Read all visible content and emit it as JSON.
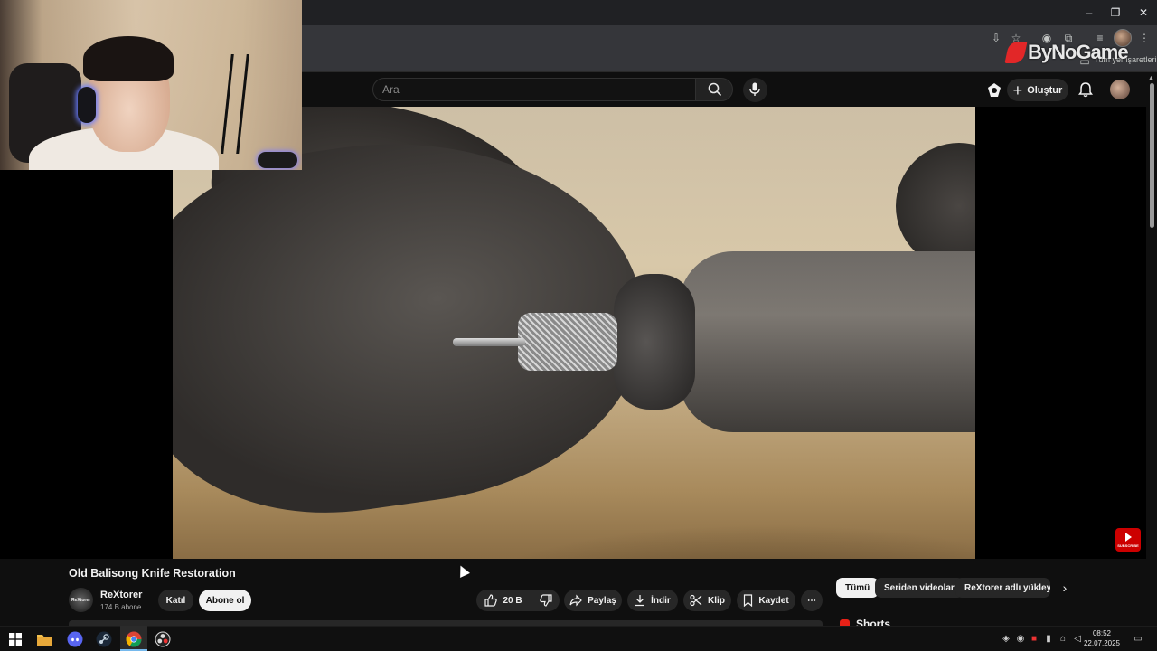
{
  "browser": {
    "window_buttons": {
      "minimize": "–",
      "maximize": "❐",
      "close": "✕"
    },
    "bookmarks_label": "Tüm yer işaretleri"
  },
  "overlay_logo": "ByNoGame",
  "header": {
    "search_placeholder": "Ara",
    "create_label": "Oluştur"
  },
  "video": {
    "title": "Old Balisong Knife Restoration",
    "subscribe_badge": "SUBSCRIBE"
  },
  "channel": {
    "avatar_text": "ReXtorer",
    "name": "ReXtorer",
    "subscribers": "174 B abone",
    "join_label": "Katıl",
    "subscribe_label": "Abone ol"
  },
  "actions": {
    "likes": "20 B",
    "share": "Paylaş",
    "download": "İndir",
    "clip": "Klip",
    "save": "Kaydet"
  },
  "chips": [
    "Tümü",
    "Seriden videolar",
    "ReXtorer adlı yükleyiciden"
  ],
  "shorts_title": "Shorts",
  "taskbar": {
    "time": "08:52",
    "date": "22.07.2025"
  },
  "colors": {
    "youtube_bg": "#0f0f0f",
    "accent_red": "#e62117",
    "chip_active_bg": "#f1f1f1"
  }
}
